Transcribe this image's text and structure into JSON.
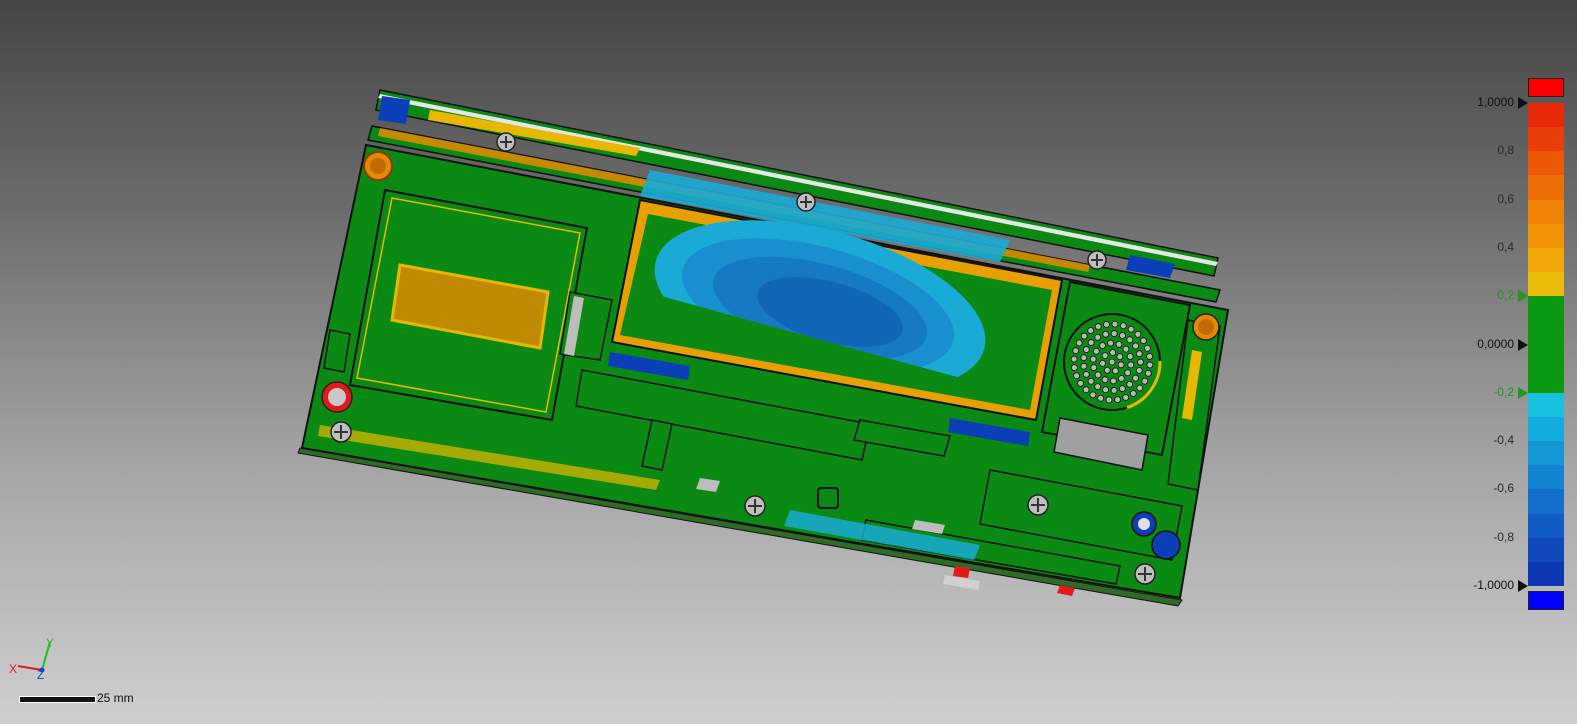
{
  "colors": {
    "green": "#0a8a12",
    "orange": "#e58a00",
    "yellow": "#e8b800",
    "blue_light": "#1aaad6",
    "blue_mid": "#1579c4",
    "blue_dark": "#0b3fb8",
    "red": "#e21a1a",
    "gray": "#a0a0a0",
    "overflow_high": "#ff0000",
    "overflow_low": "#0000ff"
  },
  "icons": [
    "screw-icon",
    "hole-icon",
    "speaker-grille-icon",
    "axis-triad-icon"
  ],
  "legend": {
    "labels": [
      {
        "id": "max",
        "text": "1,0000",
        "value": 1.0,
        "style": "major",
        "marker": "black"
      },
      {
        "id": "p08",
        "text": "0,8",
        "value": 0.8,
        "style": "minor"
      },
      {
        "id": "p06",
        "text": "0,6",
        "value": 0.6,
        "style": "minor"
      },
      {
        "id": "p04",
        "text": "0,4",
        "value": 0.4,
        "style": "minor"
      },
      {
        "id": "p02",
        "text": "0,2",
        "value": 0.2,
        "style": "tol",
        "marker": "green"
      },
      {
        "id": "zero",
        "text": "0,0000",
        "value": 0.0,
        "style": "major",
        "marker": "black"
      },
      {
        "id": "m02",
        "text": "-0,2",
        "value": -0.2,
        "style": "tol",
        "marker": "green"
      },
      {
        "id": "m04",
        "text": "-0,4",
        "value": -0.4,
        "style": "minor"
      },
      {
        "id": "m06",
        "text": "-0,6",
        "value": -0.6,
        "style": "minor"
      },
      {
        "id": "m08",
        "text": "-0,8",
        "value": -0.8,
        "style": "minor"
      },
      {
        "id": "min",
        "text": "-1,0000",
        "value": -1.0,
        "style": "major",
        "marker": "black"
      }
    ],
    "bands": [
      {
        "from": 0.9,
        "to": 1.0,
        "color": "#e82a0a"
      },
      {
        "from": 0.8,
        "to": 0.9,
        "color": "#ea3e08"
      },
      {
        "from": 0.7,
        "to": 0.8,
        "color": "#ec5806"
      },
      {
        "from": 0.6,
        "to": 0.7,
        "color": "#ee6e06"
      },
      {
        "from": 0.5,
        "to": 0.6,
        "color": "#ef8206"
      },
      {
        "from": 0.4,
        "to": 0.5,
        "color": "#f09406"
      },
      {
        "from": 0.3,
        "to": 0.4,
        "color": "#f0a808"
      },
      {
        "from": 0.2,
        "to": 0.3,
        "color": "#e8bc08"
      },
      {
        "from": -0.2,
        "to": 0.2,
        "color": "#0a9a12"
      },
      {
        "from": -0.3,
        "to": -0.2,
        "color": "#18c0e0"
      },
      {
        "from": -0.4,
        "to": -0.3,
        "color": "#14acdc"
      },
      {
        "from": -0.5,
        "to": -0.4,
        "color": "#1498d8"
      },
      {
        "from": -0.6,
        "to": -0.5,
        "color": "#1384d2"
      },
      {
        "from": -0.7,
        "to": -0.6,
        "color": "#1270ca"
      },
      {
        "from": -0.8,
        "to": -0.7,
        "color": "#105cc2"
      },
      {
        "from": -0.9,
        "to": -0.8,
        "color": "#0e48ba"
      },
      {
        "from": -1.0,
        "to": -0.9,
        "color": "#0c36b2"
      }
    ]
  },
  "axes": {
    "x": "X",
    "y": "Y",
    "z": "Z"
  },
  "scale_bar": {
    "label": "25 mm"
  }
}
